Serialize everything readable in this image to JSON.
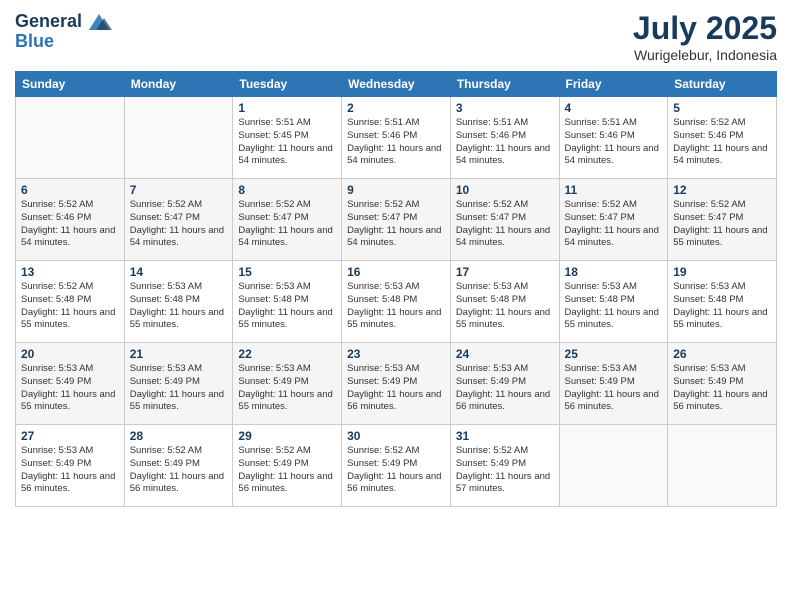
{
  "header": {
    "logo_line1": "General",
    "logo_line2": "Blue",
    "month_title": "July 2025",
    "location": "Wurigelebur, Indonesia"
  },
  "weekdays": [
    "Sunday",
    "Monday",
    "Tuesday",
    "Wednesday",
    "Thursday",
    "Friday",
    "Saturday"
  ],
  "weeks": [
    [
      {
        "day": "",
        "info": ""
      },
      {
        "day": "",
        "info": ""
      },
      {
        "day": "1",
        "info": "Sunrise: 5:51 AM\nSunset: 5:45 PM\nDaylight: 11 hours and 54 minutes."
      },
      {
        "day": "2",
        "info": "Sunrise: 5:51 AM\nSunset: 5:46 PM\nDaylight: 11 hours and 54 minutes."
      },
      {
        "day": "3",
        "info": "Sunrise: 5:51 AM\nSunset: 5:46 PM\nDaylight: 11 hours and 54 minutes."
      },
      {
        "day": "4",
        "info": "Sunrise: 5:51 AM\nSunset: 5:46 PM\nDaylight: 11 hours and 54 minutes."
      },
      {
        "day": "5",
        "info": "Sunrise: 5:52 AM\nSunset: 5:46 PM\nDaylight: 11 hours and 54 minutes."
      }
    ],
    [
      {
        "day": "6",
        "info": "Sunrise: 5:52 AM\nSunset: 5:46 PM\nDaylight: 11 hours and 54 minutes."
      },
      {
        "day": "7",
        "info": "Sunrise: 5:52 AM\nSunset: 5:47 PM\nDaylight: 11 hours and 54 minutes."
      },
      {
        "day": "8",
        "info": "Sunrise: 5:52 AM\nSunset: 5:47 PM\nDaylight: 11 hours and 54 minutes."
      },
      {
        "day": "9",
        "info": "Sunrise: 5:52 AM\nSunset: 5:47 PM\nDaylight: 11 hours and 54 minutes."
      },
      {
        "day": "10",
        "info": "Sunrise: 5:52 AM\nSunset: 5:47 PM\nDaylight: 11 hours and 54 minutes."
      },
      {
        "day": "11",
        "info": "Sunrise: 5:52 AM\nSunset: 5:47 PM\nDaylight: 11 hours and 54 minutes."
      },
      {
        "day": "12",
        "info": "Sunrise: 5:52 AM\nSunset: 5:47 PM\nDaylight: 11 hours and 55 minutes."
      }
    ],
    [
      {
        "day": "13",
        "info": "Sunrise: 5:52 AM\nSunset: 5:48 PM\nDaylight: 11 hours and 55 minutes."
      },
      {
        "day": "14",
        "info": "Sunrise: 5:53 AM\nSunset: 5:48 PM\nDaylight: 11 hours and 55 minutes."
      },
      {
        "day": "15",
        "info": "Sunrise: 5:53 AM\nSunset: 5:48 PM\nDaylight: 11 hours and 55 minutes."
      },
      {
        "day": "16",
        "info": "Sunrise: 5:53 AM\nSunset: 5:48 PM\nDaylight: 11 hours and 55 minutes."
      },
      {
        "day": "17",
        "info": "Sunrise: 5:53 AM\nSunset: 5:48 PM\nDaylight: 11 hours and 55 minutes."
      },
      {
        "day": "18",
        "info": "Sunrise: 5:53 AM\nSunset: 5:48 PM\nDaylight: 11 hours and 55 minutes."
      },
      {
        "day": "19",
        "info": "Sunrise: 5:53 AM\nSunset: 5:48 PM\nDaylight: 11 hours and 55 minutes."
      }
    ],
    [
      {
        "day": "20",
        "info": "Sunrise: 5:53 AM\nSunset: 5:49 PM\nDaylight: 11 hours and 55 minutes."
      },
      {
        "day": "21",
        "info": "Sunrise: 5:53 AM\nSunset: 5:49 PM\nDaylight: 11 hours and 55 minutes."
      },
      {
        "day": "22",
        "info": "Sunrise: 5:53 AM\nSunset: 5:49 PM\nDaylight: 11 hours and 55 minutes."
      },
      {
        "day": "23",
        "info": "Sunrise: 5:53 AM\nSunset: 5:49 PM\nDaylight: 11 hours and 56 minutes."
      },
      {
        "day": "24",
        "info": "Sunrise: 5:53 AM\nSunset: 5:49 PM\nDaylight: 11 hours and 56 minutes."
      },
      {
        "day": "25",
        "info": "Sunrise: 5:53 AM\nSunset: 5:49 PM\nDaylight: 11 hours and 56 minutes."
      },
      {
        "day": "26",
        "info": "Sunrise: 5:53 AM\nSunset: 5:49 PM\nDaylight: 11 hours and 56 minutes."
      }
    ],
    [
      {
        "day": "27",
        "info": "Sunrise: 5:53 AM\nSunset: 5:49 PM\nDaylight: 11 hours and 56 minutes."
      },
      {
        "day": "28",
        "info": "Sunrise: 5:52 AM\nSunset: 5:49 PM\nDaylight: 11 hours and 56 minutes."
      },
      {
        "day": "29",
        "info": "Sunrise: 5:52 AM\nSunset: 5:49 PM\nDaylight: 11 hours and 56 minutes."
      },
      {
        "day": "30",
        "info": "Sunrise: 5:52 AM\nSunset: 5:49 PM\nDaylight: 11 hours and 56 minutes."
      },
      {
        "day": "31",
        "info": "Sunrise: 5:52 AM\nSunset: 5:49 PM\nDaylight: 11 hours and 57 minutes."
      },
      {
        "day": "",
        "info": ""
      },
      {
        "day": "",
        "info": ""
      }
    ]
  ]
}
